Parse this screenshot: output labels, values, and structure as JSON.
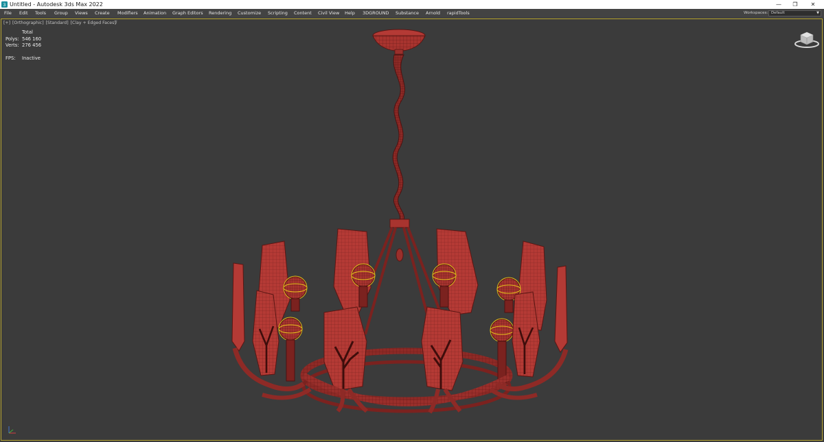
{
  "window": {
    "title": "Untitled - Autodesk 3ds Max 2022",
    "controls": {
      "minimize": "—",
      "restore": "❐",
      "close": "✕"
    }
  },
  "menu": {
    "items": [
      "File",
      "Edit",
      "Tools",
      "Group",
      "Views",
      "Create",
      "Modifiers",
      "Animation",
      "Graph Editors",
      "Rendering",
      "Customize",
      "Scripting",
      "Content",
      "Civil View",
      "Help",
      "3DGROUND",
      "Substance",
      "Arnold",
      "rapidTools"
    ],
    "workspaces_label": "Workspaces:",
    "workspace_value": "Default"
  },
  "viewport": {
    "labels": [
      "[+]",
      "[Orthographic]",
      "[Standard]",
      "[Clay + Edged Faces]"
    ],
    "stats": {
      "header": "Total",
      "polys_label": "Polys:",
      "polys_value": "546 160",
      "verts_label": "Verts:",
      "verts_value": "276 456",
      "fps_label": "FPS:",
      "fps_value": "Inactive"
    },
    "border_color": "#b8a631",
    "background_color": "#3b3b3b"
  },
  "icons": [
    "app-icon",
    "filter-icon",
    "viewcube-icon",
    "axis-tripod-icon"
  ],
  "colors": {
    "mesh": "#b43a35",
    "wire": "#5a1613",
    "selection": "#e2c21a"
  }
}
